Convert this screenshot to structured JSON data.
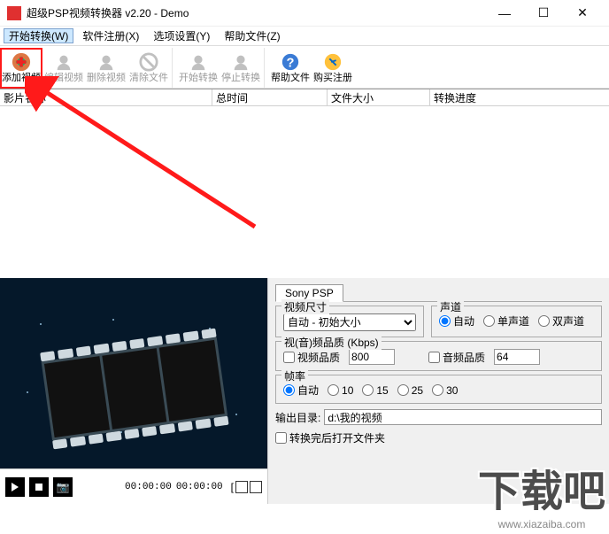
{
  "window": {
    "title": "超级PSP视频转换器 v2.20 - Demo"
  },
  "menu": {
    "start": "开始转换(W)",
    "register": "软件注册(X)",
    "options": "选项设置(Y)",
    "help": "帮助文件(Z)"
  },
  "toolbar": {
    "add": "添加视频",
    "edit": "编辑视频",
    "delete": "删除视频",
    "clear": "清除文件",
    "start": "开始转换",
    "stop": "停止转换",
    "help": "帮助文件",
    "buy": "购买注册"
  },
  "columns": {
    "name": "影片名称",
    "duration": "总时间",
    "filesize": "文件大小",
    "progress": "转换进度"
  },
  "player": {
    "time_current": "00:00:00",
    "time_total": "00:00:00"
  },
  "tabs": {
    "sony_psp": "Sony PSP"
  },
  "settings": {
    "video_size_label": "视频尺寸",
    "video_size_value": "自动 - 初始大小",
    "channels_label": "声道",
    "channel_auto": "自动",
    "channel_mono": "单声道",
    "channel_stereo": "双声道",
    "bitrate_label": "视(音)频品质 (Kbps)",
    "video_quality_label": "视频品质",
    "video_quality_value": "800",
    "audio_quality_label": "音频品质",
    "audio_quality_value": "64",
    "fps_label": "帧率",
    "fps_auto": "自动",
    "fps_10": "10",
    "fps_15": "15",
    "fps_25": "25",
    "fps_30": "30",
    "output_label": "输出目录:",
    "output_path": "d:\\我的视频",
    "post_option": "转换完后打开文件夹"
  },
  "watermark": {
    "main": "下载吧",
    "sub": "www.xiazaiba.com"
  },
  "icon_names": {
    "add": "add-video-icon",
    "edit": "edit-video-icon",
    "delete": "delete-video-icon",
    "clear": "clear-files-icon",
    "start": "start-convert-icon",
    "stop": "stop-convert-icon",
    "help": "help-icon",
    "buy": "buy-register-icon"
  },
  "colors": {
    "highlight": "#ff1a1a",
    "disabled_icon": "#c0c0c0",
    "menu_highlight_bg": "#cde8ff"
  }
}
